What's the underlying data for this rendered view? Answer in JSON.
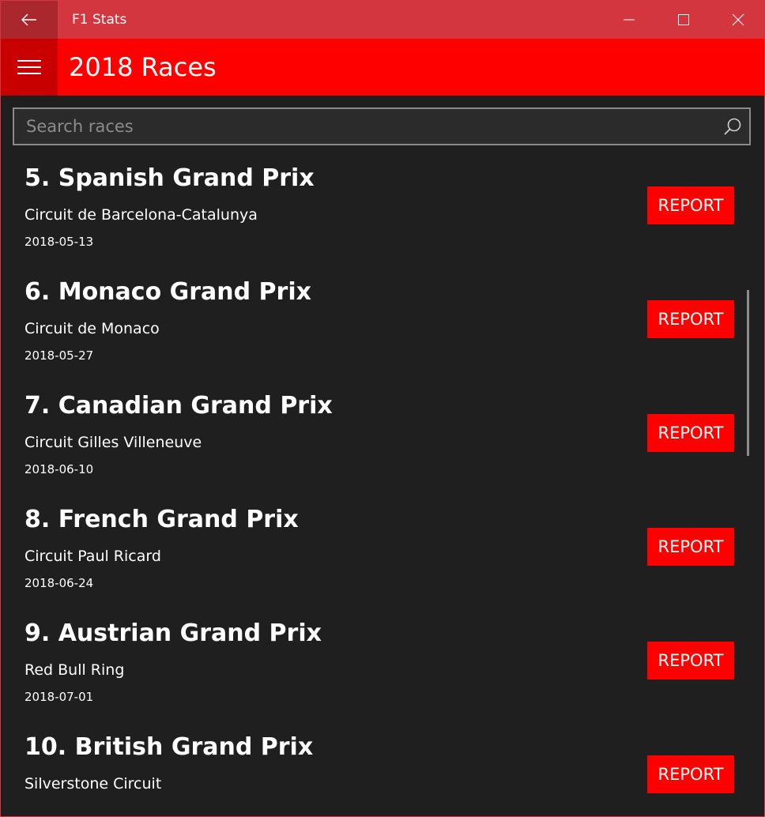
{
  "window": {
    "app_title": "F1 Stats",
    "back_icon": "back-arrow-icon",
    "minimize_icon": "minimize-icon",
    "maximize_icon": "maximize-icon",
    "close_icon": "close-icon"
  },
  "header": {
    "menu_icon": "hamburger-menu-icon",
    "title": "2018 Races"
  },
  "search": {
    "placeholder": "Search races",
    "value": "",
    "icon": "search-icon"
  },
  "races": [
    {
      "name": "5. Spanish Grand Prix",
      "circuit": "Circuit de Barcelona-Catalunya",
      "date": "2018-05-13",
      "report_label": "REPORT"
    },
    {
      "name": "6. Monaco Grand Prix",
      "circuit": "Circuit de Monaco",
      "date": "2018-05-27",
      "report_label": "REPORT"
    },
    {
      "name": "7. Canadian Grand Prix",
      "circuit": "Circuit Gilles Villeneuve",
      "date": "2018-06-10",
      "report_label": "REPORT"
    },
    {
      "name": "8. French Grand Prix",
      "circuit": "Circuit Paul Ricard",
      "date": "2018-06-24",
      "report_label": "REPORT"
    },
    {
      "name": "9. Austrian Grand Prix",
      "circuit": "Red Bull Ring",
      "date": "2018-07-01",
      "report_label": "REPORT"
    },
    {
      "name": "10. British Grand Prix",
      "circuit": "Silverstone Circuit",
      "date": "",
      "report_label": "REPORT"
    }
  ],
  "colors": {
    "title_bar": "#d3363e",
    "header": "#ff0000",
    "accent": "#ff0000",
    "background": "#1f1f1f"
  }
}
